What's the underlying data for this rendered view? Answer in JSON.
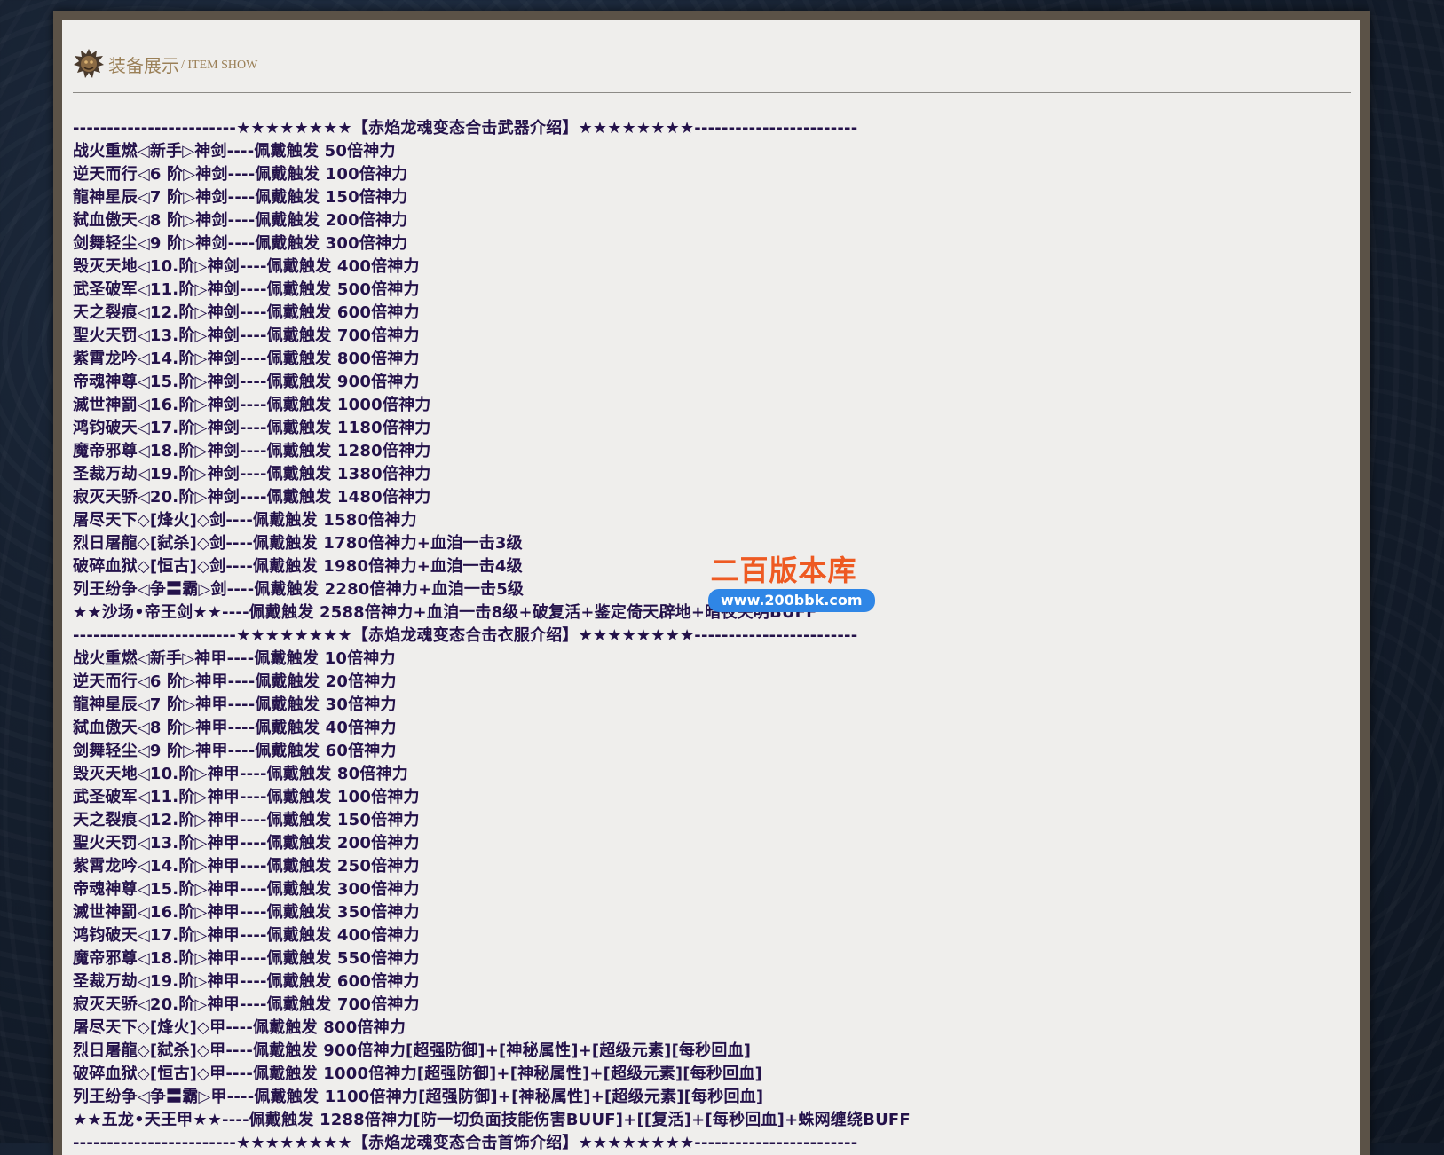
{
  "header": {
    "title_cn": "装备展示",
    "title_en": "/ ITEM SHOW"
  },
  "watermark": {
    "title": "二百版本库",
    "url": "www.200bbk.com"
  },
  "lines": [
    "------------------------★★★★★★★★【赤焰龙魂变态合击武器介绍】★★★★★★★★------------------------",
    "战火重燃◁新手▷神剑----佩戴触发 50倍神力",
    "逆天而行◁6 阶▷神剑----佩戴触发 100倍神力",
    "龍神星辰◁7 阶▷神剑----佩戴触发 150倍神力",
    "弑血傲天◁8 阶▷神剑----佩戴触发 200倍神力",
    "剑舞轻尘◁9 阶▷神剑----佩戴触发 300倍神力",
    "毁灭天地◁10.阶▷神剑----佩戴触发 400倍神力",
    "武圣破军◁11.阶▷神剑----佩戴触发 500倍神力",
    "天之裂痕◁12.阶▷神剑----佩戴触发 600倍神力",
    "聖火天罚◁13.阶▷神剑----佩戴触发 700倍神力",
    "紫霄龙吟◁14.阶▷神剑----佩戴触发 800倍神力",
    "帝魂神尊◁15.阶▷神剑----佩戴触发 900倍神力",
    "滅世神罰◁16.阶▷神剑----佩戴触发 1000倍神力",
    "鸿钧破天◁17.阶▷神剑----佩戴触发 1180倍神力",
    "魔帝邪尊◁18.阶▷神剑----佩戴触发 1280倍神力",
    "圣裁万劫◁19.阶▷神剑----佩戴触发 1380倍神力",
    "寂灭天骄◁20.阶▷神剑----佩戴触发 1480倍神力",
    "屠尽天下◇[烽火]◇剑----佩戴触发 1580倍神力",
    "烈日屠龍◇[弑杀]◇剑----佩戴触发 1780倍神力+血洎一击3级",
    "破碎血狱◇[恒古]◇剑----佩戴触发 1980倍神力+血洎一击4级",
    "列王纷争◁争〓霸▷剑----佩戴触发 2280倍神力+血洎一击5级",
    "★★沙场•帝王剑★★----佩戴触发 2588倍神力+血洎一击8级+破复活+鉴定倚天辟地+暗夜失明BUFF",
    "------------------------★★★★★★★★【赤焰龙魂变态合击衣服介绍】★★★★★★★★------------------------",
    "战火重燃◁新手▷神甲----佩戴触发 10倍神力",
    "逆天而行◁6 阶▷神甲----佩戴触发 20倍神力",
    "龍神星辰◁7 阶▷神甲----佩戴触发 30倍神力",
    "弑血傲天◁8 阶▷神甲----佩戴触发 40倍神力",
    "剑舞轻尘◁9 阶▷神甲----佩戴触发 60倍神力",
    "毁灭天地◁10.阶▷神甲----佩戴触发 80倍神力",
    "武圣破军◁11.阶▷神甲----佩戴触发 100倍神力",
    "天之裂痕◁12.阶▷神甲----佩戴触发 150倍神力",
    "聖火天罚◁13.阶▷神甲----佩戴触发 200倍神力",
    "紫霄龙吟◁14.阶▷神甲----佩戴触发 250倍神力",
    "帝魂神尊◁15.阶▷神甲----佩戴触发 300倍神力",
    "滅世神罰◁16.阶▷神甲----佩戴触发 350倍神力",
    "鸿钧破天◁17.阶▷神甲----佩戴触发 400倍神力",
    "魔帝邪尊◁18.阶▷神甲----佩戴触发 550倍神力",
    "圣裁万劫◁19.阶▷神甲----佩戴触发 600倍神力",
    "寂灭天骄◁20.阶▷神甲----佩戴触发 700倍神力",
    "屠尽天下◇[烽火]◇甲----佩戴触发 800倍神力",
    "烈日屠龍◇[弑杀]◇甲----佩戴触发 900倍神力[超强防御]+[神秘属性]+[超级元素][每秒回血]",
    "破碎血狱◇[恒古]◇甲----佩戴触发 1000倍神力[超强防御]+[神秘属性]+[超级元素][每秒回血]",
    "列王纷争◁争〓霸▷甲----佩戴触发 1100倍神力[超强防御]+[神秘属性]+[超级元素][每秒回血]",
    "★★五龙•天王甲★★----佩戴触发 1288倍神力[防一切负面技能伤害BUUF]+[[复活]+[每秒回血]+蛛网缠绕BUFF",
    "------------------------★★★★★★★★【赤焰龙魂变态合击首饰介绍】★★★★★★★★------------------------"
  ]
}
